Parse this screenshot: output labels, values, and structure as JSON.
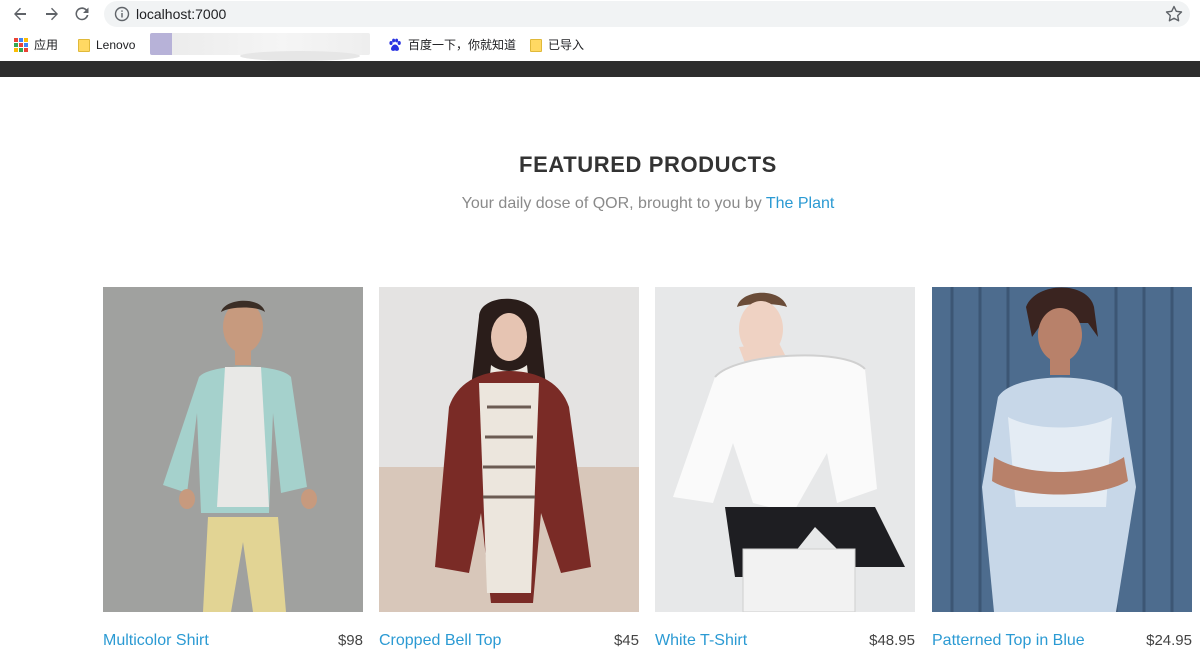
{
  "browser": {
    "url": "localhost:7000",
    "bookmarks": [
      {
        "label": "应用",
        "icon": "apps-icon"
      },
      {
        "label": "Lenovo",
        "icon": "folder-icon"
      },
      {
        "label": "百度一下，你就知道",
        "icon": "baidu-paw-icon"
      },
      {
        "label": "已导入",
        "icon": "folder-icon"
      }
    ]
  },
  "featured": {
    "title": "FEATURED PRODUCTS",
    "subtitle_prefix": "Your daily dose of QOR, brought to you by ",
    "subtitle_link": "The Plant"
  },
  "products": [
    {
      "name": "Multicolor Shirt",
      "price": "$98"
    },
    {
      "name": "Cropped Bell Top",
      "price": "$45"
    },
    {
      "name": "White T-Shirt",
      "price": "$48.95"
    },
    {
      "name": "Patterned Top in Blue",
      "price": "$24.95"
    }
  ],
  "colors": {
    "link": "#2b9ad3",
    "nav_bar": "#2d2d2d",
    "folder": "#ffd963"
  }
}
